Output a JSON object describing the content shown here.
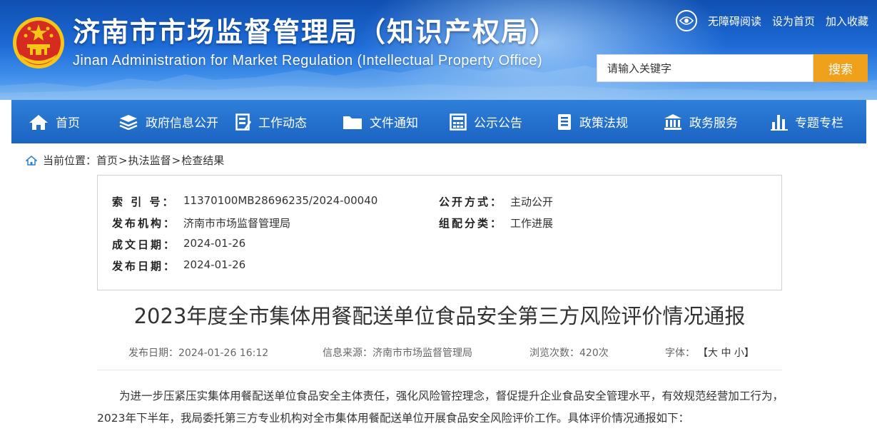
{
  "header": {
    "title": "济南市市场监督管理局（知识产权局）",
    "subtitle": "Jinan Administration for Market Regulation (Intellectual Property Office)",
    "links": [
      "无障碍阅读",
      "设为首页",
      "加入收藏"
    ],
    "search": {
      "placeholder": "请输入关键字",
      "button": "搜索"
    }
  },
  "nav": {
    "items": [
      {
        "label": "首页",
        "icon": "home-icon"
      },
      {
        "label": "政府信息公开",
        "icon": "database-icon"
      },
      {
        "label": "工作动态",
        "icon": "document-edit-icon"
      },
      {
        "label": "文件通知",
        "icon": "folder-icon"
      },
      {
        "label": "公示公告",
        "icon": "calculator-icon"
      },
      {
        "label": "政策法规",
        "icon": "book-icon"
      },
      {
        "label": "政务服务",
        "icon": "building-icon"
      },
      {
        "label": "专题专栏",
        "icon": "bar-chart-icon"
      }
    ]
  },
  "breadcrumb": {
    "prefix": "当前位置：",
    "items": [
      "首页",
      "执法监督",
      "检查结果"
    ],
    "sep": ">"
  },
  "info": {
    "index_label": "索 引 号：",
    "index_value": "11370100MB28696235/2024-00040",
    "org_label": "发布机构：",
    "org_value": "济南市市场监督管理局",
    "created_label": "成文日期：",
    "created_value": "2024-01-26",
    "published_label": "发布日期：",
    "published_value": "2024-01-26",
    "mode_label": "公开方式：",
    "mode_value": "主动公开",
    "category_label": "组配分类：",
    "category_value": "工作进展"
  },
  "article": {
    "title": "2023年度全市集体用餐配送单位食品安全第三方风险评价情况通报",
    "meta": {
      "date": "发布日期：2024-01-26 16:12",
      "source": "信息来源：济南市市场监督管理局",
      "views": "浏览次数：420次",
      "font_label": "字体：",
      "font_sizes": "【大 中 小】"
    },
    "body": "为进一步压紧压实集体用餐配送单位食品安全主体责任，强化风险管控理念，督促提升企业食品安全管理水平，有效规范经营加工行为，2023年下半年，我局委托第三方专业机构对全市集体用餐配送单位开展食品安全风险评价工作。具体评价情况通报如下："
  }
}
